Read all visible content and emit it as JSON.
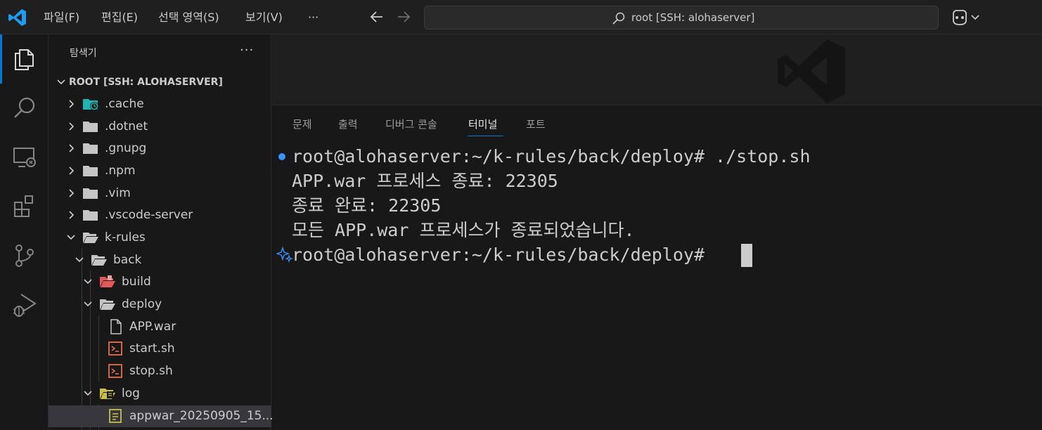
{
  "menu": {
    "file": "파일(F)",
    "edit": "편집(E)",
    "selection": "선택 영역(S)",
    "view": "보기(V)",
    "more": "···"
  },
  "search": {
    "text": "root [SSH: alohaserver]"
  },
  "sidebar": {
    "title": "탐색기",
    "more": "···",
    "root_label": "ROOT [SSH: ALOHASERVER]",
    "items": [
      {
        "label": ".cache",
        "icon": "folder-cache-icon"
      },
      {
        "label": ".dotnet",
        "icon": "folder-icon"
      },
      {
        "label": ".gnupg",
        "icon": "folder-icon"
      },
      {
        "label": ".npm",
        "icon": "folder-icon"
      },
      {
        "label": ".vim",
        "icon": "folder-icon"
      },
      {
        "label": ".vscode-server",
        "icon": "folder-icon"
      },
      {
        "label": "k-rules",
        "icon": "folder-open-icon"
      },
      {
        "label": "back",
        "icon": "folder-open-icon"
      },
      {
        "label": "build",
        "icon": "folder-build-icon"
      },
      {
        "label": "deploy",
        "icon": "folder-open-icon"
      },
      {
        "label": "APP.war",
        "icon": "file-icon"
      },
      {
        "label": "start.sh",
        "icon": "shell-script-icon"
      },
      {
        "label": "stop.sh",
        "icon": "shell-script-icon"
      },
      {
        "label": "log",
        "icon": "folder-log-icon"
      },
      {
        "label": "appwar_20250905_15...",
        "icon": "log-file-icon"
      }
    ]
  },
  "panel": {
    "tabs": [
      "문제",
      "출력",
      "디버그 콘솔",
      "터미널",
      "포트"
    ],
    "active_tab": "터미널"
  },
  "terminal": {
    "lines": [
      "root@alohaserver:~/k-rules/back/deploy# ./stop.sh",
      "APP.war 프로세스 종료: 22305",
      "종료 완료: 22305",
      "모든 APP.war 프로세스가 종료되었습니다.",
      "root@alohaserver:~/k-rules/back/deploy# "
    ]
  },
  "colors": {
    "accent": "#0078d4",
    "folder": "#c5c5c5",
    "shell": "#e8704a",
    "log_folder": "#c8c04a",
    "cache_folder": "#22b5b0",
    "build_folder": "#e05a5a",
    "terminal_dot": "#3794ff"
  }
}
